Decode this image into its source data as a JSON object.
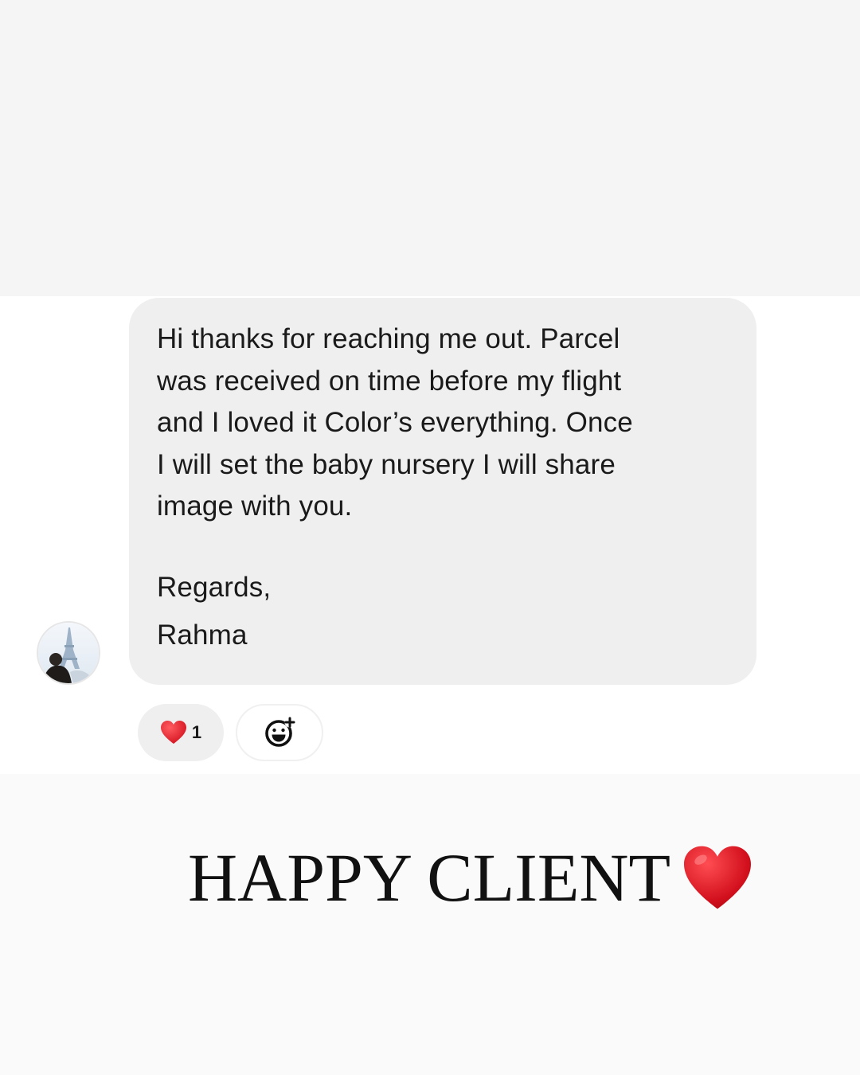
{
  "message": {
    "lines": [
      "Hi thanks for reaching me out. Parcel",
      "was received on time before my flight",
      "and I loved it Color’s everything. Once",
      "I will set the baby nursery I will share",
      "image with you."
    ],
    "closing": "Regards,",
    "signature": "Rahma"
  },
  "reactions": {
    "emoji_icon": "red-heart-icon",
    "count": "1",
    "add_icon": "add-reaction-smiley-icon"
  },
  "caption": {
    "text": "HAPPY CLIENT",
    "emoji_icon": "red-heart-icon"
  },
  "colors": {
    "bubble": "#efefef",
    "heart": "#d9131e",
    "text": "#1a1a1a"
  }
}
